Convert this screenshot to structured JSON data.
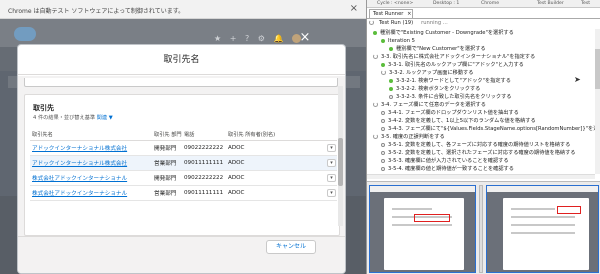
{
  "browser": {
    "infobar_message": "Chrome は自動テスト ソフトウェアによって制御されています。",
    "infobar_close": "×"
  },
  "modal": {
    "title": "取引先名",
    "close": "×",
    "card_title": "取引先",
    "card_subtitle": "4 件の結果・並び替え基準 ",
    "card_sort": "関連",
    "sort_caret": "▼",
    "columns": [
      "取引先名",
      "取引先 部門",
      "電話",
      "取引先 所有者(別名)"
    ],
    "rows": [
      {
        "name": "アドックインターナショナル株式会社",
        "dept": "開発部門",
        "phone": "09022222222",
        "owner": "ADOC"
      },
      {
        "name": "アドックインターナショナル株式会社",
        "dept": "営業部門",
        "phone": "09011111111",
        "owner": "ADOC"
      },
      {
        "name": "株式会社アドックインターナショナル",
        "dept": "開発部門",
        "phone": "09022222222",
        "owner": "ADOC"
      },
      {
        "name": "株式会社アドックインターナショナル",
        "dept": "営業部門",
        "phone": "09011111111",
        "owner": "ADOC"
      }
    ],
    "row_menu": "▾",
    "cancel_label": "キャンセル"
  },
  "salesforce": {
    "header_icons": [
      "★",
      "+",
      "?",
      "⚙",
      "🔔"
    ]
  },
  "test_builder": {
    "top_items": [
      "Cycle : <none>",
      "Desktop : 1",
      "Chrome",
      "Test Builder",
      "Test"
    ],
    "tab_label": "Test Runner",
    "tab_close": "×",
    "run_label": "Test Run (19)",
    "running": "running ...",
    "tree": [
      {
        "indent": 0,
        "icon": "g",
        "text": "種別欄で\"Existing Customer - Downgrade\"を選択する"
      },
      {
        "indent": 1,
        "icon": "g",
        "text": "Iteration 5"
      },
      {
        "indent": 2,
        "icon": "g",
        "text": "種別欄で\"New Customer\"を選択する"
      },
      {
        "indent": 0,
        "icon": "s",
        "text": "3-3. 取引先名に株式会社アドックインターナショナル\"を指定する"
      },
      {
        "indent": 1,
        "icon": "g",
        "text": "3-3-1. 取引先名のルックアップ欄に\"アドック\"と入力する"
      },
      {
        "indent": 1,
        "icon": "s",
        "text": "3-3-2. ルックアップ画面に移動する"
      },
      {
        "indent": 2,
        "icon": "g",
        "text": "3-3-2-1. 検索ワードとして\"アドック\"を指定する"
      },
      {
        "indent": 2,
        "icon": "g",
        "text": "3-3-2-2. 検索ボタンをクリックする"
      },
      {
        "indent": 2,
        "icon": "o",
        "text": "3-3-2-3. 条件に合致した取引先名をクリックする"
      },
      {
        "indent": 0,
        "icon": "s",
        "text": "3-4. フェーズ欄にて任意のデータを選択する"
      },
      {
        "indent": 1,
        "icon": "o",
        "text": "3-4-1. フェーズ欄のドロップダウンリスト値を抽出する"
      },
      {
        "indent": 1,
        "icon": "o",
        "text": "3-4-2. 変数を定義して、1以上5以下のランダムな値を格納する"
      },
      {
        "indent": 1,
        "icon": "o",
        "text": "3-4-3. フェーズ欄にて\"${Values.Fields.StageName.options[RandomNumber]}\"を選択する"
      },
      {
        "indent": 0,
        "icon": "s",
        "text": "3-5. 確度の正誤判断をする"
      },
      {
        "indent": 1,
        "icon": "o",
        "text": "3-5-1. 変数を定義して、各フェーズに対応する確度の期待値リストを格納する"
      },
      {
        "indent": 1,
        "icon": "o",
        "text": "3-5-2. 変数を定義して、選択されたフェーズに対応する確度の期待値を格納する"
      },
      {
        "indent": 1,
        "icon": "o",
        "text": "3-5-3. 確度欄に値が入力されていることを確認する"
      },
      {
        "indent": 1,
        "icon": "o",
        "text": "3-5-4. 確度欄の値と期待値が一致することを確認する"
      }
    ]
  }
}
